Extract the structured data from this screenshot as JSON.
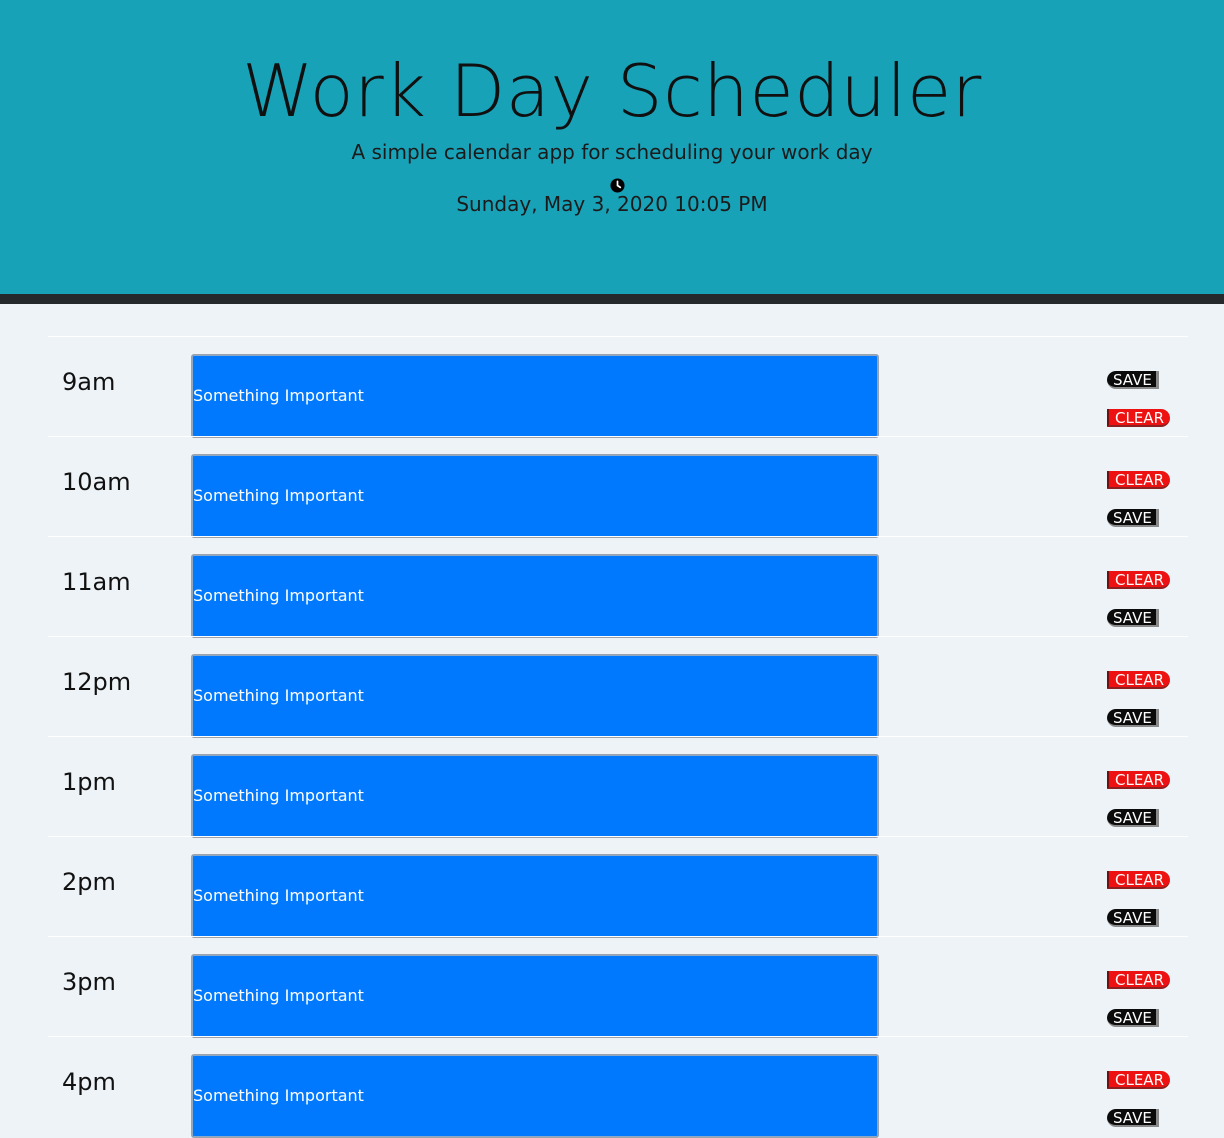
{
  "header": {
    "title": "Work Day Scheduler",
    "subtitle": "A simple calendar app for scheduling your work day",
    "clock_icon": "clock-icon",
    "current_date": "Sunday, May 3, 2020 10:05 PM"
  },
  "buttons": {
    "save_label": "SAVE",
    "clear_label": "CLEAR"
  },
  "colors": {
    "header_bg": "#18a2b8",
    "task_bg": "#0079fe",
    "save_bg": "#0b0b0b",
    "clear_bg": "#ee1111"
  },
  "rows": [
    {
      "hour": "9am",
      "task": "Something Important",
      "save_first": true
    },
    {
      "hour": "10am",
      "task": "Something Important",
      "save_first": false
    },
    {
      "hour": "11am",
      "task": "Something Important",
      "save_first": false
    },
    {
      "hour": "12pm",
      "task": "Something Important",
      "save_first": false
    },
    {
      "hour": "1pm",
      "task": "Something Important",
      "save_first": false
    },
    {
      "hour": "2pm",
      "task": "Something Important",
      "save_first": false
    },
    {
      "hour": "3pm",
      "task": "Something Important",
      "save_first": false
    },
    {
      "hour": "4pm",
      "task": "Something Important",
      "save_first": false
    }
  ]
}
